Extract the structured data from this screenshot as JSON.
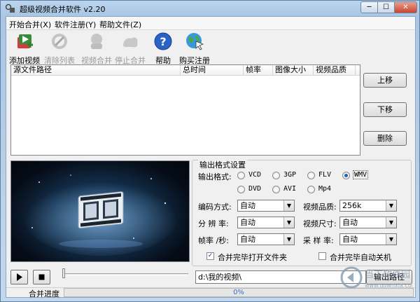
{
  "window": {
    "title": "超级视频合并软件 v2.20",
    "minimize": "─",
    "maximize": "☐",
    "close": "✕"
  },
  "menu": [
    {
      "label": "开始合并(X)"
    },
    {
      "label": "软件注册(Y)"
    },
    {
      "label": "帮助文件(Z)"
    }
  ],
  "toolbar": {
    "add_video": "添加视频",
    "clear_list": "清除列表",
    "merge_video": "视频合并",
    "stop_merge": "停止合并",
    "help": "帮助",
    "buy_register": "购买注册"
  },
  "file_list": {
    "columns": [
      "源文件路径",
      "总时间",
      "帧率",
      "图像大小",
      "视频品质"
    ]
  },
  "side_buttons": {
    "move_up": "上移",
    "move_down": "下移",
    "delete": "删除"
  },
  "output": {
    "group_title": "输出格式设置",
    "format_label": "输出格式:",
    "formats": [
      "VCD",
      "3GP",
      "FLV",
      "WMV",
      "DVD",
      "AVI",
      "Mp4"
    ],
    "selected_format": "WMV",
    "encoding_label": "编码方式:",
    "encoding_value": "自动",
    "quality_label": "视频品质:",
    "quality_value": "256k",
    "resolution_label": "分 辨 率:",
    "resolution_value": "自动",
    "size_label": "视频尺寸:",
    "size_value": "自动",
    "fps_label": "帧率 /秒:",
    "fps_value": "自动",
    "sample_label": "采 样 率:",
    "sample_value": "自动",
    "open_folder_label": "合并完毕打开文件夹",
    "open_folder_checked": true,
    "shutdown_label": "合并完毕自动关机",
    "shutdown_checked": false
  },
  "bottom": {
    "output_path": "d:\\我的视频\\",
    "output_path_button": "输出路径",
    "progress_label": "合并进度",
    "progress_text": "0%",
    "progress": 0
  },
  "watermark": {
    "line1": "当下软件园",
    "line2": "www.downxia.com"
  }
}
